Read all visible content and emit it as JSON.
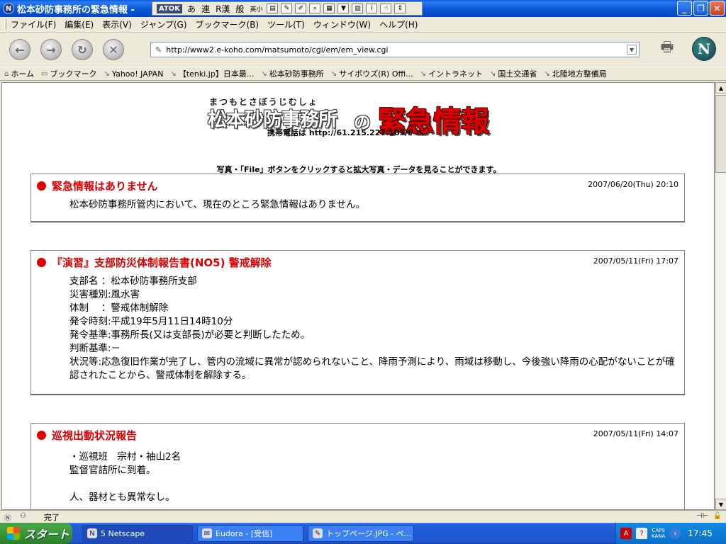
{
  "window": {
    "title": "松本砂防事務所の緊急情報 -"
  },
  "ime": {
    "atok": "ATOK",
    "modes": [
      "あ",
      "連",
      "R漢",
      "般",
      "英小"
    ]
  },
  "menu": [
    "ファイル(F)",
    "編集(E)",
    "表示(V)",
    "ジャンプ(G)",
    "ブックマーク(B)",
    "ツール(T)",
    "ウィンドウ(W)",
    "ヘルプ(H)"
  ],
  "nav": {
    "url": "http://www2.e-koho.com/matsumoto/cgi/em/em_view.cgi"
  },
  "bookmarks": [
    "ホーム",
    "ブックマーク",
    "Yahoo! JAPAN",
    "【tenki.jp】日本最...",
    "松本砂防事務所",
    "サイボウズ(R) Offi...",
    "イントラネット",
    "国土交通省",
    "北陸地方整備局"
  ],
  "page": {
    "furigana": "まつもとさぼうじむしょ",
    "office_name": "松本砂防事務所",
    "no": "の",
    "emergency": "緊急情報",
    "mobile": "携帯電話は http://61.215.227.165/i/ へ",
    "notice": "写真・「File」ボタンをクリックすると拡大写真・データを見ることができます。",
    "panels": [
      {
        "title": "緊急情報はありません",
        "date": "2007/06/20(Thu) 20:10",
        "lines": [
          "松本砂防事務所管内において、現在のところ緊急情報はありません。"
        ]
      },
      {
        "title": "『演習』支部防災体制報告書(NO5) 警戒解除",
        "date": "2007/05/11(Fri) 17:07",
        "lines": [
          "支部名 ：松本砂防事務所支部",
          "災害種別:風水害",
          "体制　 ：警戒体制解除",
          "発令時刻:平成19年5月11日14時10分",
          "発令基準:事務所長(又は支部長)が必要と判断したため。",
          "判断基準:－",
          "状況等:応急復旧作業が完了し、管内の流域に異常が認められないこと、降雨予測により、雨域は移動し、今後強い降雨の心配がないことが確認されたことから、警戒体制を解除する。"
        ]
      },
      {
        "title": "巡視出動状況報告",
        "date": "2007/05/11(Fri) 14:07",
        "lines": [
          "・巡視班　宗村・袖山2名",
          "監督官詰所に到着。",
          "",
          "人、器材とも異常なし。"
        ]
      }
    ]
  },
  "status": {
    "text": "完了"
  },
  "taskbar": {
    "start": "スタート",
    "tasks": [
      "5 Netscape",
      "Eudora - [受信]",
      "トップページ.JPG - ペ..."
    ],
    "caps": "CAPS",
    "kana": "KANA",
    "clock": "17:45"
  }
}
